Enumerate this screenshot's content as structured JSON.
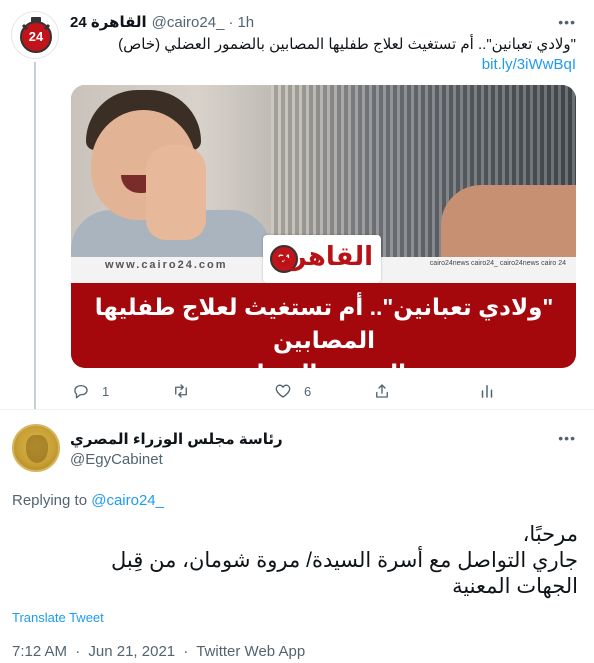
{
  "parent_tweet": {
    "author_name": "القاهرة 24",
    "handle": "@cairo24_",
    "time": "1h",
    "text": "\"ولادي تعبانين\".. أم تستغيث لعلاج طفليها المصابين بالضمور العضلي (خاص)",
    "link": "bit.ly/3iWwBqI",
    "avatar_label": "24",
    "media": {
      "site": "www.cairo24.com",
      "socials": "cairo24news  cairo24_  cairo24news  cairo 24",
      "logo_text": "القاهرة",
      "logo_badge": "24",
      "headline_line1": "\"ولادي تعبانين\".. أم تستغيث لعلاج طفليها المصابين",
      "headline_line2": "بالضمور العضلي"
    },
    "actions": {
      "reply_count": "1",
      "retweet_count": "",
      "like_count": "6"
    }
  },
  "reply_tweet": {
    "author_name": "رئاسة مجلس الوزراء المصري",
    "handle": "@EgyCabinet",
    "replying_prefix": "Replying to",
    "replying_to": "@cairo24_",
    "text_lines": [
      "مرحبًا،",
      "جاري التواصل مع أسرة السيدة/ مروة شومان، من قِبل",
      "الجهات المعنية"
    ],
    "translate_label": "Translate Tweet",
    "time": "7:12 AM",
    "date": "Jun 21, 2021",
    "app": "Twitter Web App",
    "separator": "·"
  },
  "colors": {
    "link_blue": "#1d9bf0",
    "secondary_text": "#536471",
    "banner_red": "#a4080d",
    "thread_line": "#c4cfd6"
  },
  "icons": [
    "reply-icon",
    "retweet-icon",
    "like-icon",
    "share-icon",
    "analytics-icon",
    "more-icon"
  ]
}
